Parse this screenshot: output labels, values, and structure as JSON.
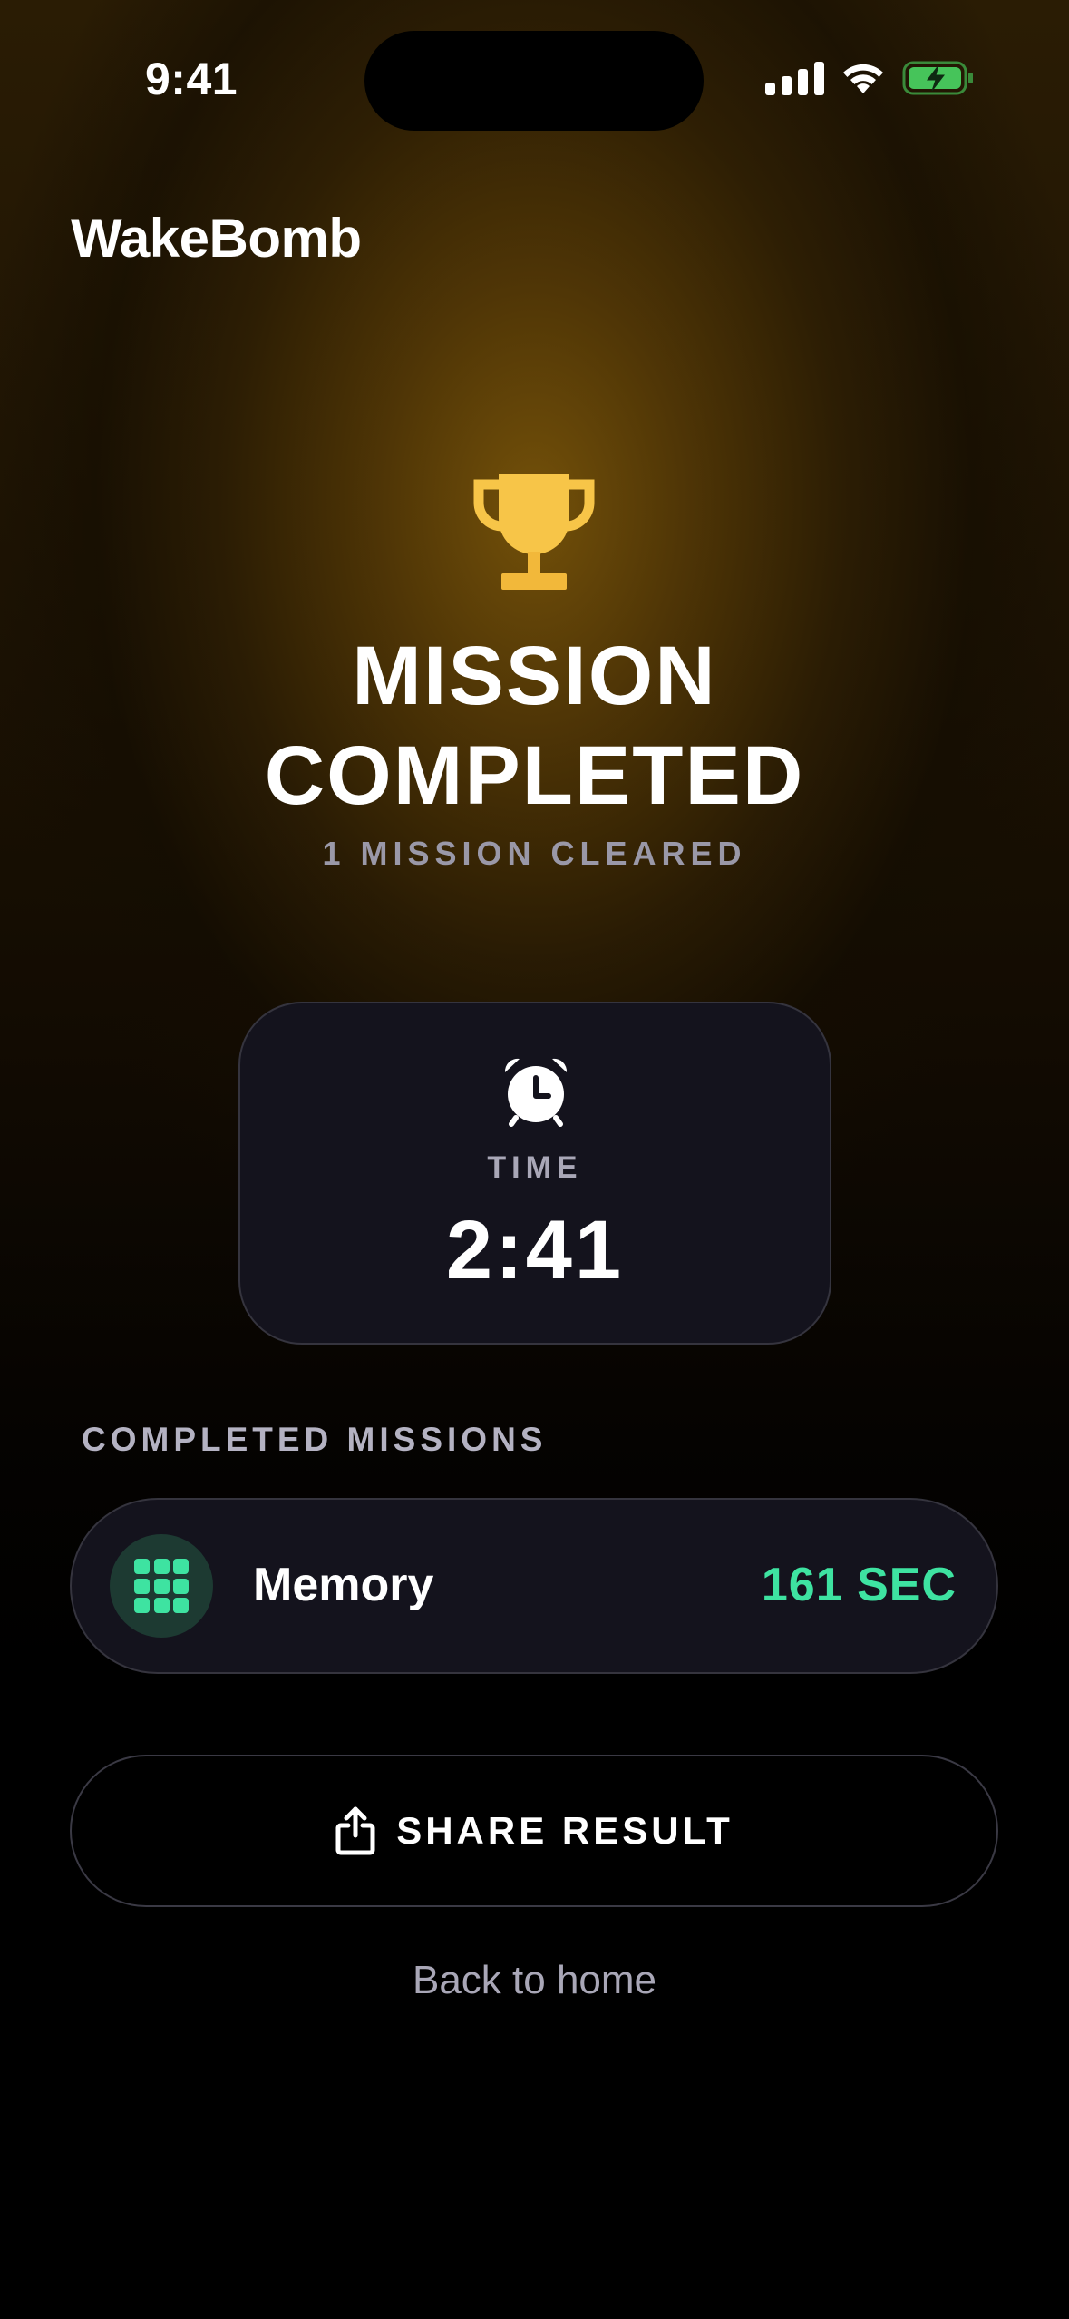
{
  "status_bar": {
    "time": "9:41",
    "icons": [
      "cellular-signal-icon",
      "wifi-icon",
      "battery-charging-icon"
    ]
  },
  "header": {
    "app_title": "WakeBomb"
  },
  "hero": {
    "icon": "trophy-icon",
    "headline_line1": "MISSION",
    "headline_line2": "COMPLETED",
    "subtitle": "1 MISSION CLEARED"
  },
  "time_card": {
    "icon": "alarm-clock-icon",
    "label": "TIME",
    "value": "2:41"
  },
  "completed_missions": {
    "title": "COMPLETED MISSIONS",
    "items": [
      {
        "icon": "grid-icon",
        "name": "Memory",
        "duration": "161 SEC"
      }
    ]
  },
  "actions": {
    "share_label": "SHARE RESULT",
    "back_label": "Back to home"
  },
  "colors": {
    "accent_green": "#3ee3a1",
    "trophy_gold": "#f7c548",
    "card_bg": "#14131d"
  }
}
